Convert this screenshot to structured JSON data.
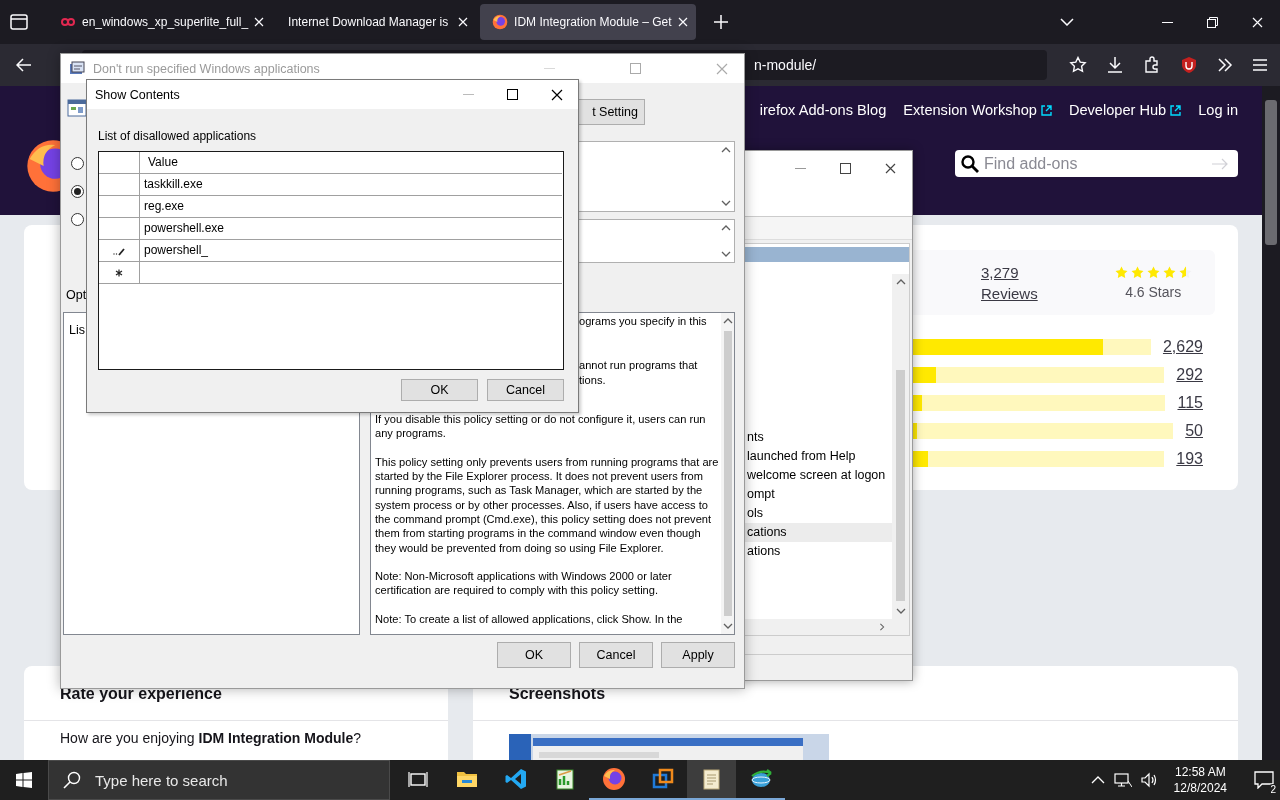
{
  "browser": {
    "tabs": [
      {
        "label": "en_windows_xp_superlite_full_",
        "selected": false
      },
      {
        "label": "Internet Download Manager is",
        "selected": false
      },
      {
        "label": "IDM Integration Module – Get",
        "selected": true
      }
    ],
    "url": "n-module/"
  },
  "site": {
    "nav": [
      {
        "label": "irefox Add-ons Blog",
        "external": false
      },
      {
        "label": "Extension Workshop",
        "external": true
      },
      {
        "label": "Developer Hub",
        "external": true
      },
      {
        "label": "Log in",
        "external": false
      }
    ],
    "search": {
      "placeholder": "Find add-ons"
    },
    "ratings": {
      "count": "3,279",
      "count_label": "Reviews",
      "stars": 4.6,
      "average": "4.6 Stars",
      "bars": [
        {
          "level": 0.8,
          "count": "2,629"
        },
        {
          "level": 0.09,
          "count": "292"
        },
        {
          "level": 0.035,
          "count": "115"
        },
        {
          "level": 0.015,
          "count": "50"
        },
        {
          "level": 0.06,
          "count": "193"
        }
      ]
    },
    "rate_card": {
      "title": "Rate your experience",
      "prompt": "How are you enjoying **IDM Integration Module**?"
    },
    "screenshots_card": {
      "title": "Screenshots"
    }
  },
  "gpedit": {
    "items": [
      {
        "label": "nts",
        "selected": false
      },
      {
        "label": "launched from Help",
        "selected": false
      },
      {
        "label": "welcome screen at logon",
        "selected": false
      },
      {
        "label": "ompt",
        "selected": false
      },
      {
        "label": "ols",
        "selected": false
      },
      {
        "label": "cations",
        "selected": true
      },
      {
        "label": "ations",
        "selected": false
      }
    ]
  },
  "policy": {
    "title": "Don't run specified Windows applications",
    "radios": [
      {
        "selected": false
      },
      {
        "selected": true
      },
      {
        "selected": false
      }
    ],
    "setting_button": "t Setting",
    "options_label": "Opt",
    "options_text": "Lis",
    "help_fragments": [
      "ograms you specify in this",
      "annot run programs that",
      "tions."
    ],
    "help_paragraphs": [
      "If you disable this policy setting or do not configure it, users can run any programs.",
      "This policy setting only prevents users from running programs that are started by the File Explorer process. It does not prevent users from running programs, such as Task Manager, which are started by the system process or by other processes.  Also, if users have access to the command prompt (Cmd.exe), this policy setting does not prevent them from starting programs in the command window even though they would be prevented from doing so using File Explorer.",
      "Note: Non-Microsoft applications with Windows 2000 or later certification are required to comply with this policy setting.",
      "Note: To create a list of allowed applications, click Show.  In the"
    ],
    "buttons": [
      "OK",
      "Cancel",
      "Apply"
    ]
  },
  "show_contents": {
    "title": "Show Contents",
    "label": "List of disallowed applications",
    "column": "Value",
    "rows": [
      {
        "kind": "normal",
        "value": "taskkill.exe"
      },
      {
        "kind": "normal",
        "value": "reg.exe"
      },
      {
        "kind": "normal",
        "value": "powershell.exe"
      },
      {
        "kind": "editing",
        "value": "powershell_"
      },
      {
        "kind": "new"
      }
    ],
    "buttons": [
      "OK",
      "Cancel"
    ]
  },
  "taskbar": {
    "search_placeholder": "Type here to search",
    "apps": [
      {
        "running": false,
        "selected": false
      },
      {
        "running": false,
        "selected": false
      },
      {
        "running": false,
        "selected": false
      },
      {
        "running": true,
        "selected": false
      },
      {
        "running": true,
        "selected": false
      },
      {
        "running": true,
        "selected": true
      },
      {
        "running": true,
        "selected": false
      }
    ],
    "time": "12:58 AM",
    "date": "12/8/2024",
    "notifications": "2"
  }
}
